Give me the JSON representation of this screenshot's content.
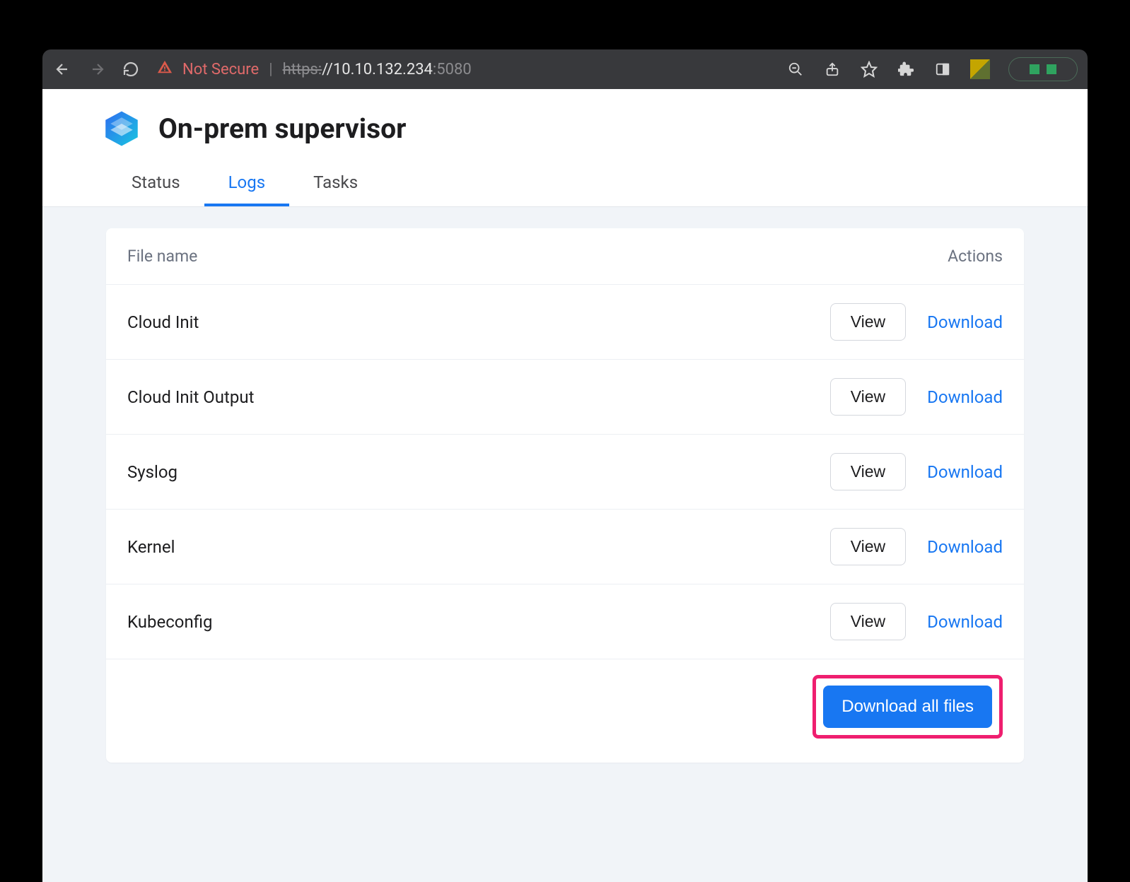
{
  "browser": {
    "not_secure": "Not Secure",
    "url_scheme": "https:",
    "url_host": "//10.10.132.234",
    "url_port": ":5080"
  },
  "header": {
    "title": "On-prem supervisor"
  },
  "tabs": [
    {
      "label": "Status",
      "active": false
    },
    {
      "label": "Logs",
      "active": true
    },
    {
      "label": "Tasks",
      "active": false
    }
  ],
  "table": {
    "col_name": "File name",
    "col_actions": "Actions",
    "view_label": "View",
    "download_label": "Download",
    "rows": [
      {
        "name": "Cloud Init"
      },
      {
        "name": "Cloud Init Output"
      },
      {
        "name": "Syslog"
      },
      {
        "name": "Kernel"
      },
      {
        "name": "Kubeconfig"
      }
    ],
    "download_all": "Download all files"
  }
}
